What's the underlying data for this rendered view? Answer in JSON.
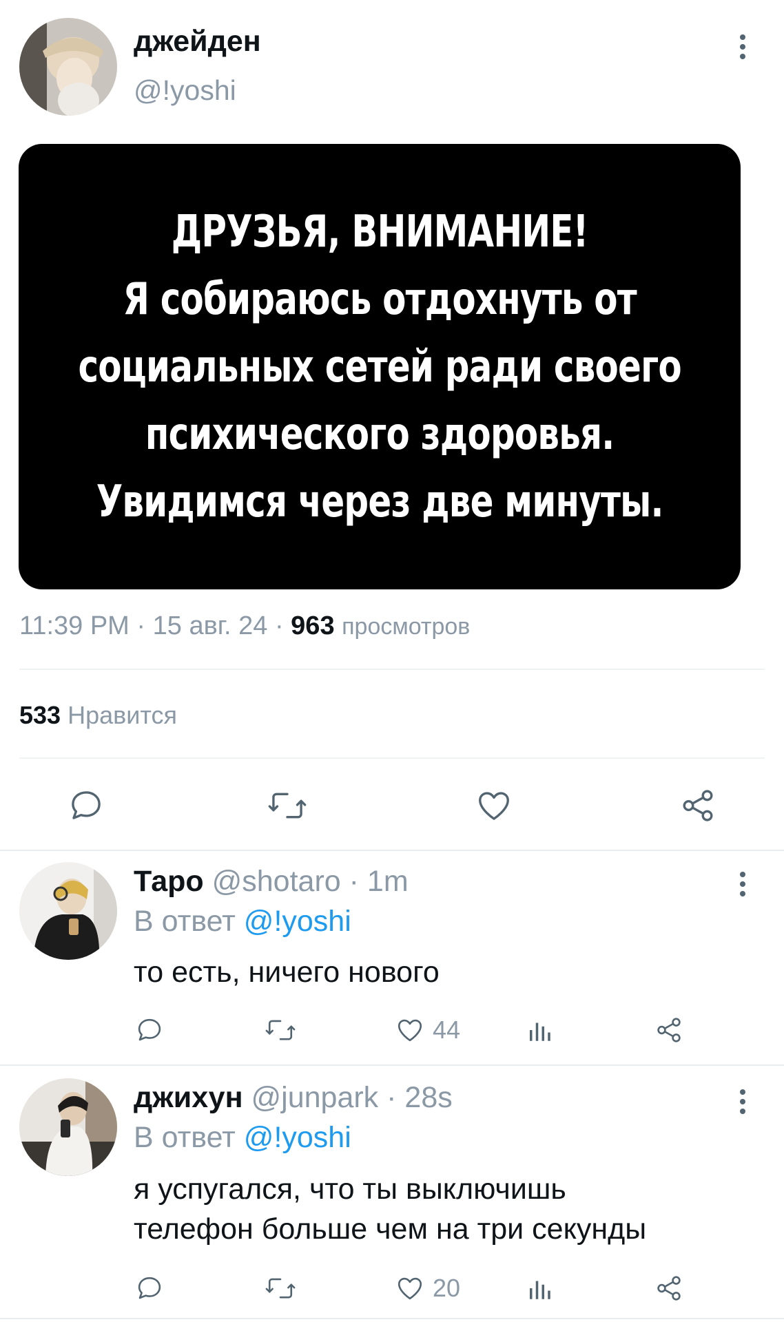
{
  "tweet": {
    "display_name": "джейден",
    "handle": "@!yoshi",
    "image_lines": [
      "ДРУЗЬЯ, ВНИМАНИЕ!",
      "Я собираюсь отдохнуть от",
      "социальных сетей ради своего",
      "психического здоровья.",
      "Увидимся через две минуты."
    ],
    "time": "11:39 PM",
    "date": "15 авг. 24",
    "views_count": "963",
    "views_label": "просмотров",
    "likes_count": "533",
    "likes_label": "Нравится"
  },
  "replies": [
    {
      "display_name": "Таро",
      "handle": "@shotaro",
      "time": "1m",
      "reply_prefix": "В ответ",
      "reply_to": "@!yoshi",
      "text_lines": [
        "то есть, ничего нового"
      ],
      "likes": "44"
    },
    {
      "display_name": "джихун",
      "handle": "@junpark",
      "time": "28s",
      "reply_prefix": "В ответ",
      "reply_to": "@!yoshi",
      "text_lines": [
        "я успугался, что ты выключишь",
        "телефон больше чем на три секунды"
      ],
      "likes": "20"
    }
  ],
  "separator": "·",
  "icons": [
    "more-icon",
    "reply-icon",
    "retweet-icon",
    "like-icon",
    "share-icon",
    "views-icon"
  ],
  "colors": {
    "accent": "#1d9bf0",
    "secondary_text": "#8b98a5",
    "divider": "#eff3f4"
  }
}
